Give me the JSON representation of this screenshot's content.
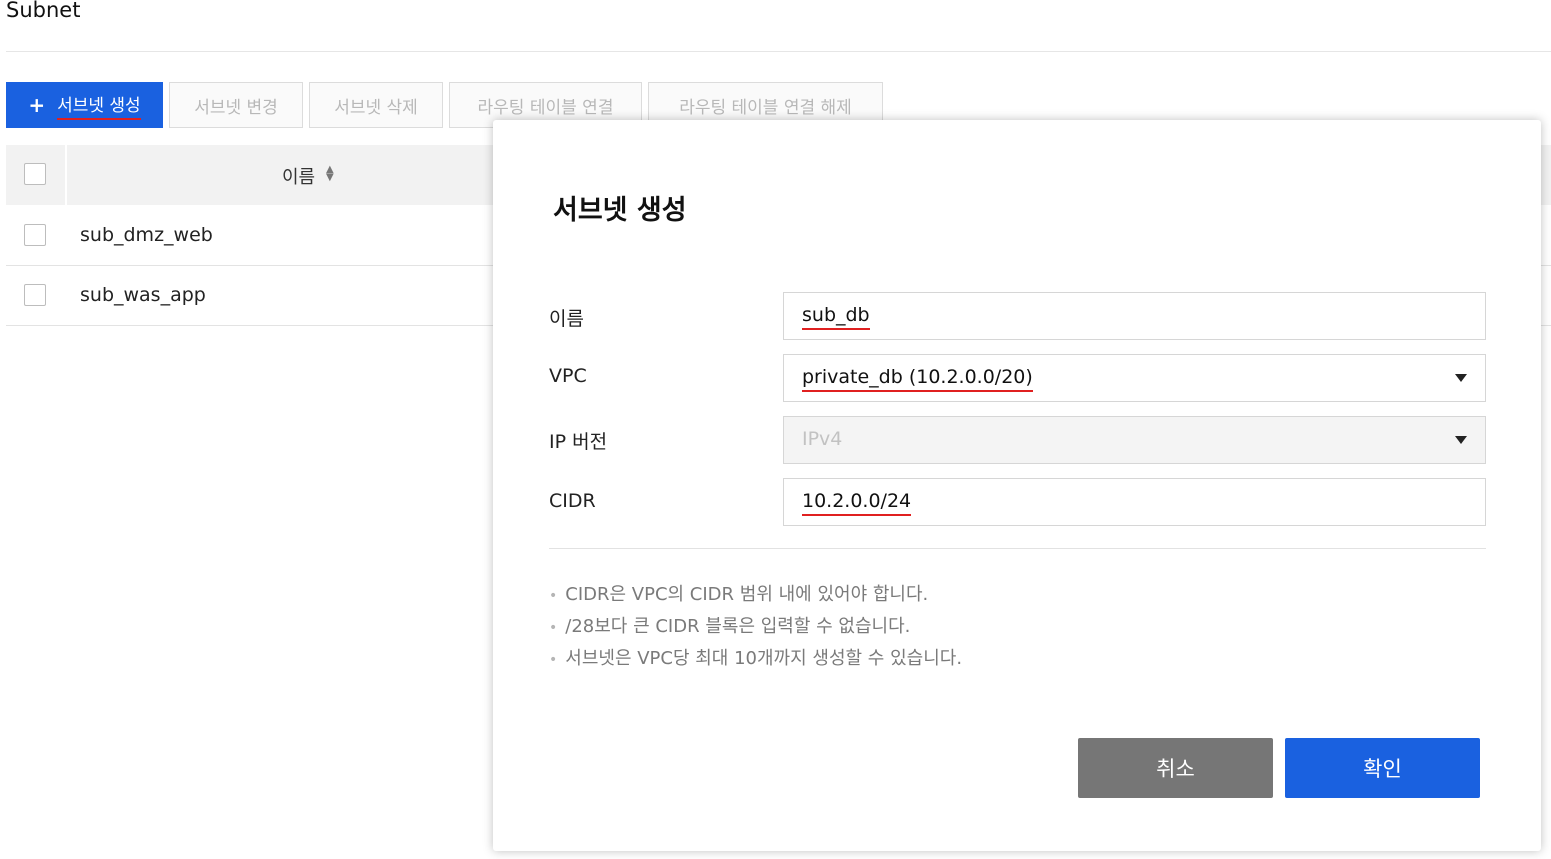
{
  "page": {
    "title": "Subnet"
  },
  "toolbar": {
    "create_plus": "+",
    "create_label": "서브넷 생성",
    "edit_label": "서브넷 변경",
    "delete_label": "서브넷 삭제",
    "route_connect_label": "라우팅 테이블 연결",
    "route_disconnect_label": "라우팅 테이블 연결 해제"
  },
  "table": {
    "header_name": "이름",
    "sort_icon": "sort-icon",
    "rows": [
      {
        "name": "sub_dmz_web"
      },
      {
        "name": "sub_was_app"
      }
    ]
  },
  "modal": {
    "title": "서브넷 생성",
    "fields": {
      "name_label": "이름",
      "name_value": "sub_db",
      "vpc_label": "VPC",
      "vpc_value": "private_db (10.2.0.0/20)",
      "ip_version_label": "IP 버전",
      "ip_version_value": "IPv4",
      "cidr_label": "CIDR",
      "cidr_value": "10.2.0.0/24"
    },
    "notes": [
      "CIDR은 VPC의 CIDR 범위 내에 있어야 합니다.",
      "/28보다 큰 CIDR 블록은 입력할 수 없습니다.",
      "서브넷은 VPC당 최대 10개까지 생성할 수 있습니다."
    ],
    "cancel_label": "취소",
    "ok_label": "확인"
  },
  "colors": {
    "primary": "#1a61e0",
    "cancel": "#767676",
    "highlight_underline": "#e02020"
  }
}
